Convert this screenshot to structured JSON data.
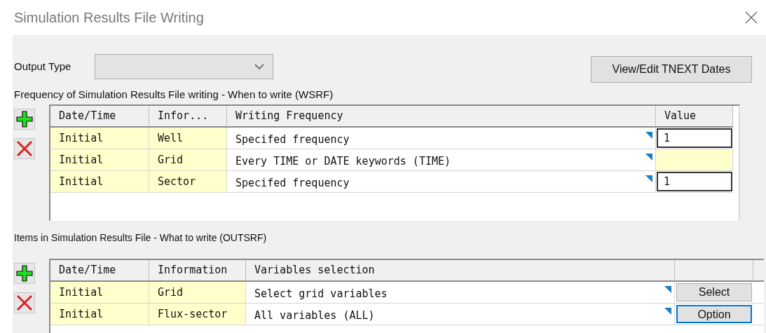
{
  "window": {
    "title": "Simulation Results File Writing"
  },
  "output_type": {
    "label": "Output Type"
  },
  "tnext_button": "View/Edit TNEXT Dates",
  "frequency": {
    "title": "Frequency of Simulation Results File writing -  When to write (WSRF)",
    "columns": [
      "Date/Time",
      "Infor...",
      "Writing Frequency",
      "Value"
    ],
    "rows": [
      {
        "date_time": "Initial",
        "information": "Well",
        "writing_frequency": "Specifed frequency",
        "value_editable": true,
        "value": "1"
      },
      {
        "date_time": "Initial",
        "information": "Grid",
        "writing_frequency": "Every TIME or DATE keywords (TIME)",
        "value_editable": false
      },
      {
        "date_time": "Initial",
        "information": "Sector",
        "writing_frequency": "Specifed frequency",
        "value_editable": true,
        "value": "1"
      }
    ]
  },
  "items": {
    "title": "Items in Simulation Results File - What to write (OUTSRF)",
    "columns": [
      "Date/Time",
      "Information",
      "Variables selection"
    ],
    "rows": [
      {
        "date_time": "Initial",
        "information": "Grid",
        "variables": "Select grid variables",
        "action": "Select",
        "focused": false
      },
      {
        "date_time": "Initial",
        "information": "Flux-sector",
        "variables": "All variables (ALL)",
        "action": "Option",
        "focused": true
      }
    ]
  }
}
